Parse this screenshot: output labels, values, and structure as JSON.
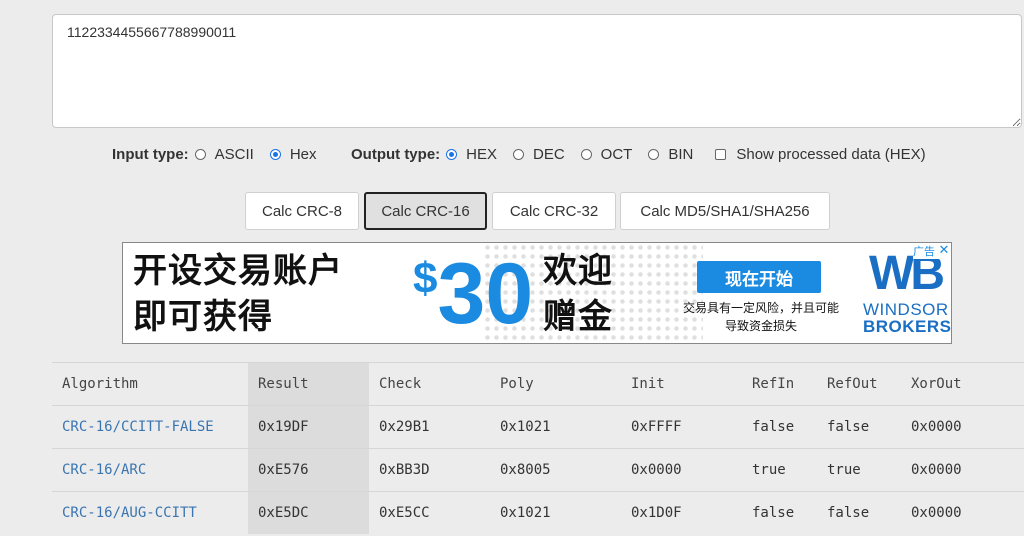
{
  "input": {
    "value": "1122334455667788990011"
  },
  "input_type": {
    "label": "Input type:",
    "options": [
      {
        "label": "ASCII",
        "checked": false
      },
      {
        "label": "Hex",
        "checked": true
      }
    ]
  },
  "output_type": {
    "label": "Output type:",
    "options": [
      {
        "label": "HEX",
        "checked": true
      },
      {
        "label": "DEC",
        "checked": false
      },
      {
        "label": "OCT",
        "checked": false
      },
      {
        "label": "BIN",
        "checked": false
      }
    ]
  },
  "show_processed": {
    "label": "Show processed data (HEX)",
    "checked": false
  },
  "buttons": {
    "crc8": "Calc CRC-8",
    "crc16": "Calc CRC-16",
    "crc32": "Calc CRC-32",
    "hash": "Calc MD5/SHA1/SHA256"
  },
  "ad": {
    "line1": "开设交易账户",
    "line2": "即可获得",
    "dollar": "$",
    "amount": "30",
    "bonus1": "欢迎",
    "bonus2": "赠金",
    "cta": "现在开始",
    "disclaimer1": "交易具有一定风险，并且可能",
    "disclaimer2": "导致资金损失",
    "logo_mark": "WB",
    "logo_name1": "WINDSOR",
    "logo_name2": "BROKERS",
    "tag": "广告",
    "close": "✕"
  },
  "table": {
    "headers": [
      "Algorithm",
      "Result",
      "Check",
      "Poly",
      "Init",
      "RefIn",
      "RefOut",
      "XorOut"
    ],
    "rows": [
      [
        "CRC-16/CCITT-FALSE",
        "0x19DF",
        "0x29B1",
        "0x1021",
        "0xFFFF",
        "false",
        "false",
        "0x0000"
      ],
      [
        "CRC-16/ARC",
        "0xE576",
        "0xBB3D",
        "0x8005",
        "0x0000",
        "true",
        "true",
        "0x0000"
      ],
      [
        "CRC-16/AUG-CCITT",
        "0xE5DC",
        "0xE5CC",
        "0x1021",
        "0x1D0F",
        "false",
        "false",
        "0x0000"
      ]
    ]
  },
  "colors": {
    "link": "#3a75b0",
    "accent": "#1a73e8",
    "ad_blue": "#1a8be0"
  }
}
